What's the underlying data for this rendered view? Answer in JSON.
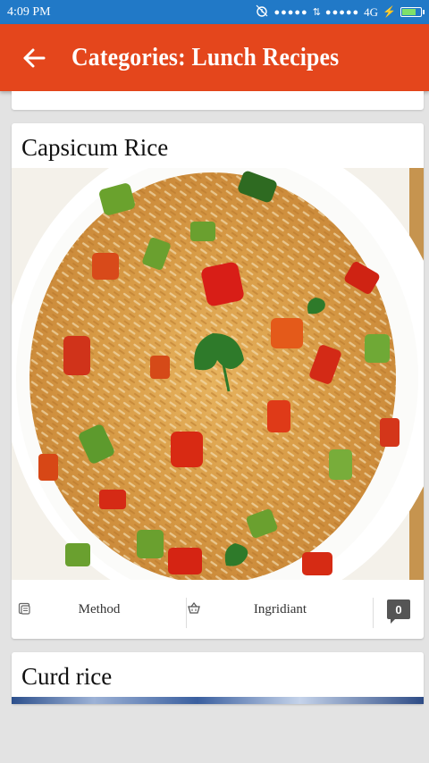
{
  "status_bar": {
    "time": "4:09 PM",
    "signal_1": "●●●●●",
    "signal_2": "●●●●●",
    "network": "4G"
  },
  "app_bar": {
    "title": "Categories: Lunch Recipes",
    "back_icon": "arrow-left-icon"
  },
  "cards": [
    {
      "title": "Capsicum Rice",
      "image": "capsicum-rice-photo",
      "actions": {
        "method_label": "Method",
        "ingredient_label": "Ingridiant",
        "comment_count": "0"
      }
    },
    {
      "title": "Curd rice",
      "image": "curd-rice-photo"
    }
  ],
  "colors": {
    "status_bar": "#2179c7",
    "app_bar": "#e4461c",
    "background": "#e3e3e3"
  }
}
